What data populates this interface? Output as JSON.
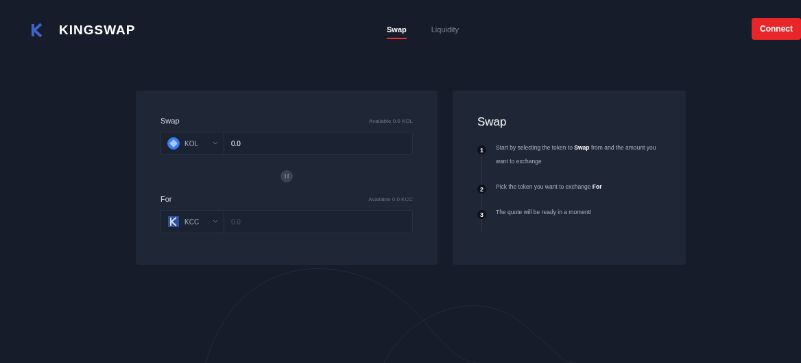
{
  "header": {
    "brand": "KINGSWAP",
    "tabs": [
      {
        "label": "Swap",
        "selected": true
      },
      {
        "label": "Liquidity",
        "selected": false
      }
    ],
    "connect": "Connect"
  },
  "swap_card": {
    "from": {
      "label": "Swap",
      "available": "Available 0.0 KOL",
      "token": "KOL",
      "value": "0.0"
    },
    "to": {
      "label": "For",
      "available": "Available 0.0 KCC",
      "token": "KCC",
      "placeholder": "0.0"
    }
  },
  "guide": {
    "title": "Swap",
    "steps": [
      {
        "number": "1",
        "text": "Start by selecting the token to **Swap** from and the amount you want to exchange"
      },
      {
        "number": "2",
        "text": "Pick the token you want to exchange **For**"
      },
      {
        "number": "3",
        "text": "The quote will be ready in a moment!"
      }
    ]
  }
}
